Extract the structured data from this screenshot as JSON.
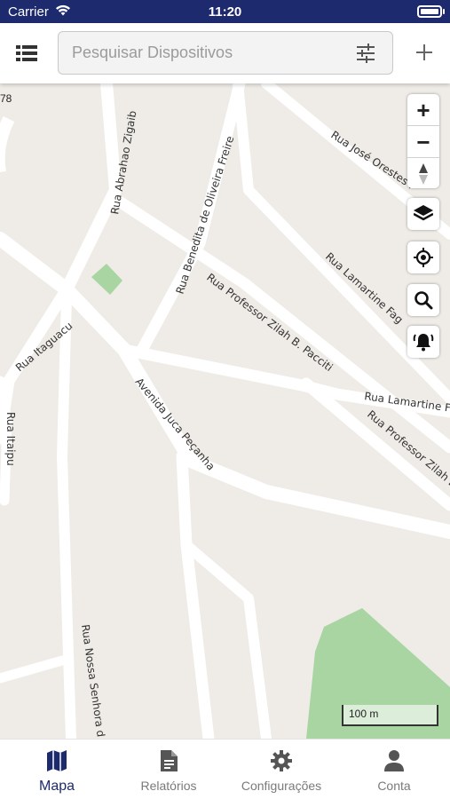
{
  "status_bar": {
    "carrier": "Carrier",
    "time": "11:20"
  },
  "search": {
    "placeholder": "Pesquisar Dispositivos",
    "value": ""
  },
  "map": {
    "corner_coord_label": "78",
    "scale_label": "100 m",
    "street_labels": [
      {
        "name": "Rua Abrahao Zigaib"
      },
      {
        "name": "Rua Benedita de Oliveira Freire"
      },
      {
        "name": "Rua José Orestes F"
      },
      {
        "name": "Rua Lamartine Fag"
      },
      {
        "name": "Rua Professor Zilah B. Pacciti"
      },
      {
        "name": "Rua Lamartine F"
      },
      {
        "name": "Rua Professor Zilah B"
      },
      {
        "name": "Rua Itaguacu"
      },
      {
        "name": "Rua Itaipu"
      },
      {
        "name": "Avenida Juca Peçanha"
      },
      {
        "name": "Rua Nossa Senhora d"
      }
    ]
  },
  "map_controls": {
    "zoom_in": "+",
    "zoom_out": "−",
    "icons": [
      "compass-icon",
      "layers-icon",
      "locate-icon",
      "search-icon",
      "alarm-icon"
    ]
  },
  "tabs": [
    {
      "label": "Mapa",
      "icon": "map-icon",
      "active": true
    },
    {
      "label": "Relatórios",
      "icon": "document-icon",
      "active": false
    },
    {
      "label": "Configurações",
      "icon": "gear-icon",
      "active": false
    },
    {
      "label": "Conta",
      "icon": "person-icon",
      "active": false
    }
  ],
  "colors": {
    "brand": "#1e2a6e",
    "map_background": "#efece7",
    "road": "#ffffff",
    "park": "#a8d5a2",
    "inactive_tab": "#7a7a7a"
  }
}
